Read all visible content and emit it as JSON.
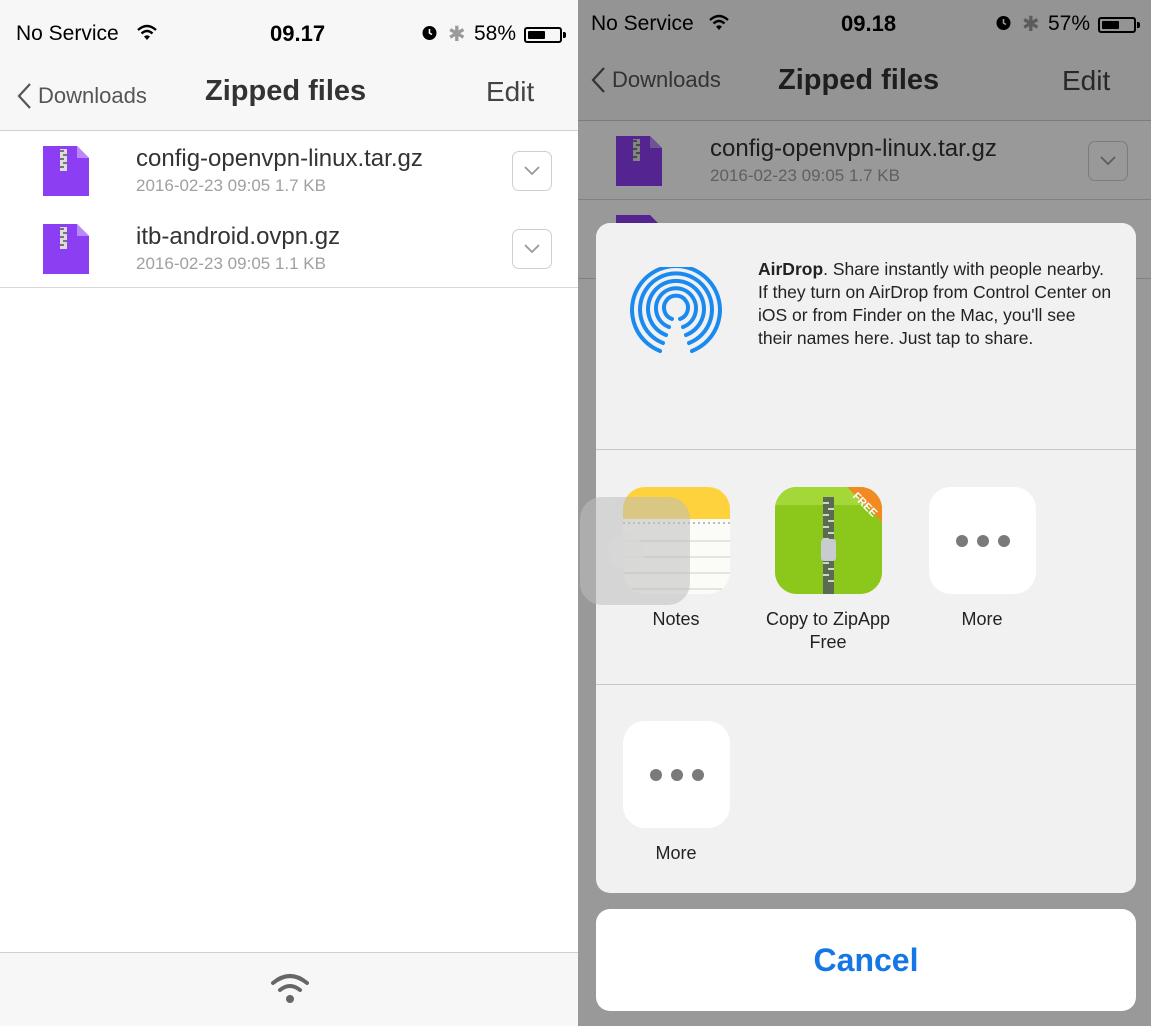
{
  "left": {
    "status": {
      "carrier": "No Service",
      "time": "09.17",
      "battery": "58%",
      "battery_level": 0.58
    },
    "nav": {
      "back": "Downloads",
      "title": "Zipped files",
      "edit": "Edit"
    },
    "files": [
      {
        "name": "config-openvpn-linux.tar.gz",
        "meta": "2016-02-23 09:05 1.7 KB"
      },
      {
        "name": "itb-android.ovpn.gz",
        "meta": "2016-02-23 09:05 1.1 KB"
      }
    ],
    "toolbar_icon": "wifi-icon"
  },
  "right": {
    "status": {
      "carrier": "No Service",
      "time": "09.18",
      "battery": "57%",
      "battery_level": 0.57
    },
    "nav": {
      "back": "Downloads",
      "title": "Zipped files",
      "edit": "Edit"
    },
    "files": [
      {
        "name": "config-openvpn-linux.tar.gz",
        "meta": "2016-02-23 09:05 1.7 KB"
      }
    ],
    "share_sheet": {
      "airdrop_title": "AirDrop",
      "airdrop_text": ". Share instantly with people nearby. If they turn on AirDrop from Control Center on iOS or from Finder on the Mac, you'll see their names here. Just tap to share.",
      "apps": [
        {
          "label": "Notes",
          "icon": "notes-app-icon"
        },
        {
          "label": "Copy to ZipApp Free",
          "icon": "zipapp-free-icon",
          "badge": "FREE"
        },
        {
          "label": "More",
          "icon": "more-dots-icon"
        }
      ],
      "actions": [
        {
          "label": "More",
          "icon": "more-dots-icon"
        }
      ],
      "cancel": "Cancel"
    }
  },
  "colors": {
    "accent": "#1577e6",
    "zip_purple": "#8c3ff2",
    "zip_green": "#8cc81c",
    "notes_yellow": "#fdd23c"
  }
}
